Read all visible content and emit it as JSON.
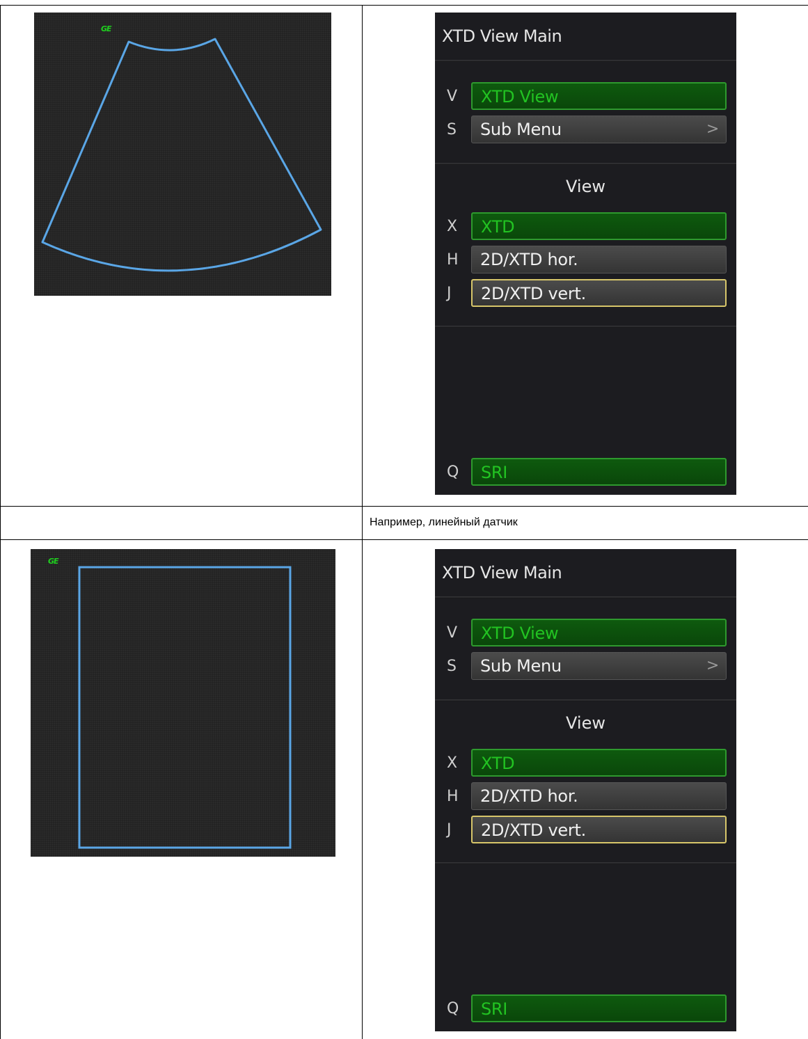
{
  "caption": "Например, линейный датчик",
  "sections": [
    {
      "image": {
        "logo_text": "GE",
        "shape": "sector"
      },
      "panel": {
        "title": "XTD View Main",
        "top_items": [
          {
            "key": "V",
            "label": "XTD View",
            "style": "green"
          },
          {
            "key": "S",
            "label": "Sub Menu",
            "style": "gray",
            "chevron": ">"
          }
        ],
        "view_title": "View",
        "view_items": [
          {
            "key": "X",
            "label": "XTD",
            "style": "green"
          },
          {
            "key": "H",
            "label": "2D/XTD hor.",
            "style": "gray"
          },
          {
            "key": "J",
            "label": "2D/XTD vert.",
            "style": "yellow"
          }
        ],
        "bottom_item": {
          "key": "Q",
          "label": "SRI",
          "style": "green"
        }
      }
    },
    {
      "image": {
        "logo_text": "GE",
        "shape": "linear"
      },
      "panel": {
        "title": "XTD View Main",
        "top_items": [
          {
            "key": "V",
            "label": "XTD View",
            "style": "green"
          },
          {
            "key": "S",
            "label": "Sub Menu",
            "style": "gray",
            "chevron": ">"
          }
        ],
        "view_title": "View",
        "view_items": [
          {
            "key": "X",
            "label": "XTD",
            "style": "green"
          },
          {
            "key": "H",
            "label": "2D/XTD hor.",
            "style": "gray"
          },
          {
            "key": "J",
            "label": "2D/XTD vert.",
            "style": "yellow"
          }
        ],
        "bottom_item": {
          "key": "Q",
          "label": "SRI",
          "style": "green"
        }
      }
    }
  ]
}
